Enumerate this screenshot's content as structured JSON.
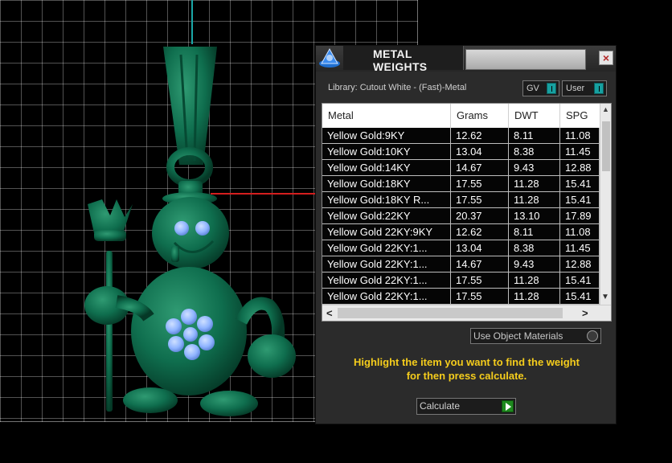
{
  "dialog": {
    "title": "METAL WEIGHTS",
    "close_label": "×",
    "library_label": "Library: Cutout White - (Fast)-Metal",
    "gv_toggle_label": "GV",
    "user_toggle_label": "User",
    "use_object_materials_label": "Use Object Materials",
    "instruction_line1": "Highlight the item you want to find the weight",
    "instruction_line2": "for then press calculate.",
    "calculate_label": "Calculate"
  },
  "table": {
    "columns": [
      "Metal",
      "Grams",
      "DWT",
      "SPG"
    ],
    "rows": [
      [
        "Yellow Gold:9KY",
        "12.62",
        "8.11",
        "11.08"
      ],
      [
        "Yellow Gold:10KY",
        "13.04",
        "8.38",
        "11.45"
      ],
      [
        "Yellow Gold:14KY",
        "14.67",
        "9.43",
        "12.88"
      ],
      [
        "Yellow Gold:18KY",
        "17.55",
        "11.28",
        "15.41"
      ],
      [
        "Yellow Gold:18KY R...",
        "17.55",
        "11.28",
        "15.41"
      ],
      [
        "Yellow Gold:22KY",
        "20.37",
        "13.10",
        "17.89"
      ],
      [
        "Yellow Gold 22KY:9KY",
        "12.62",
        "8.11",
        "11.08"
      ],
      [
        "Yellow Gold 22KY:1...",
        "13.04",
        "8.38",
        "11.45"
      ],
      [
        "Yellow Gold 22KY:1...",
        "14.67",
        "9.43",
        "12.88"
      ],
      [
        "Yellow Gold 22KY:1...",
        "17.55",
        "11.28",
        "15.41"
      ],
      [
        "Yellow Gold 22KY:1...",
        "17.55",
        "11.28",
        "15.41"
      ]
    ]
  },
  "scroll": {
    "up": "▲",
    "down": "▼",
    "left": "<",
    "right": ">"
  },
  "colors": {
    "dialog_bg": "#2b2b2b",
    "row_bg": "#050505",
    "instruction_text": "#f5cd1c",
    "model_green": "#0f6e4e",
    "button_blue": "#8fb4ff",
    "axis_cyan": "#1aa7a7",
    "axis_red": "#d41e1e"
  }
}
